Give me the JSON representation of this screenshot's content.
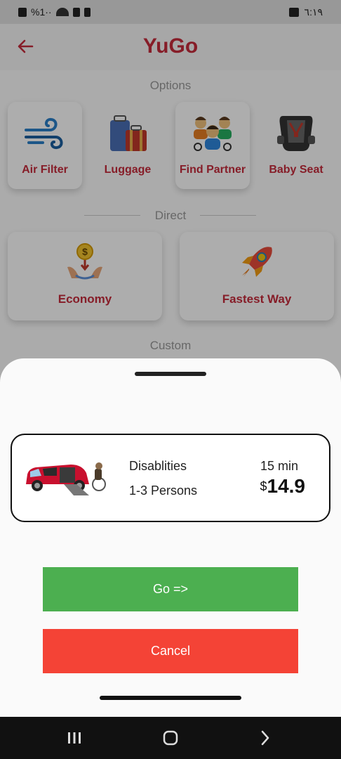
{
  "status_bar": {
    "left_text": "%1··",
    "time": "٦:١٩"
  },
  "app_bar": {
    "title": "YuGo",
    "back_icon": "arrow-left-icon"
  },
  "sections": {
    "options_label": "Options",
    "direct_label": "Direct",
    "custom_label": "Custom"
  },
  "options": [
    {
      "label": "Air Filter",
      "icon": "air-filter-icon"
    },
    {
      "label": "Luggage",
      "icon": "luggage-icon"
    },
    {
      "label": "Find Partner",
      "icon": "find-partner-icon"
    },
    {
      "label": "Baby Seat",
      "icon": "baby-seat-icon"
    }
  ],
  "direct": [
    {
      "label": "Economy",
      "icon": "economy-icon"
    },
    {
      "label": "Fastest Way",
      "icon": "rocket-icon"
    }
  ],
  "ride": {
    "type": "Disablities",
    "persons": "1-3 Persons",
    "time": "15 min",
    "currency": "$",
    "price": "14.9"
  },
  "buttons": {
    "go": "Go =>",
    "cancel": "Cancel"
  },
  "colors": {
    "brand": "#c62b3c",
    "go": "#4caf50",
    "cancel": "#f44336"
  }
}
